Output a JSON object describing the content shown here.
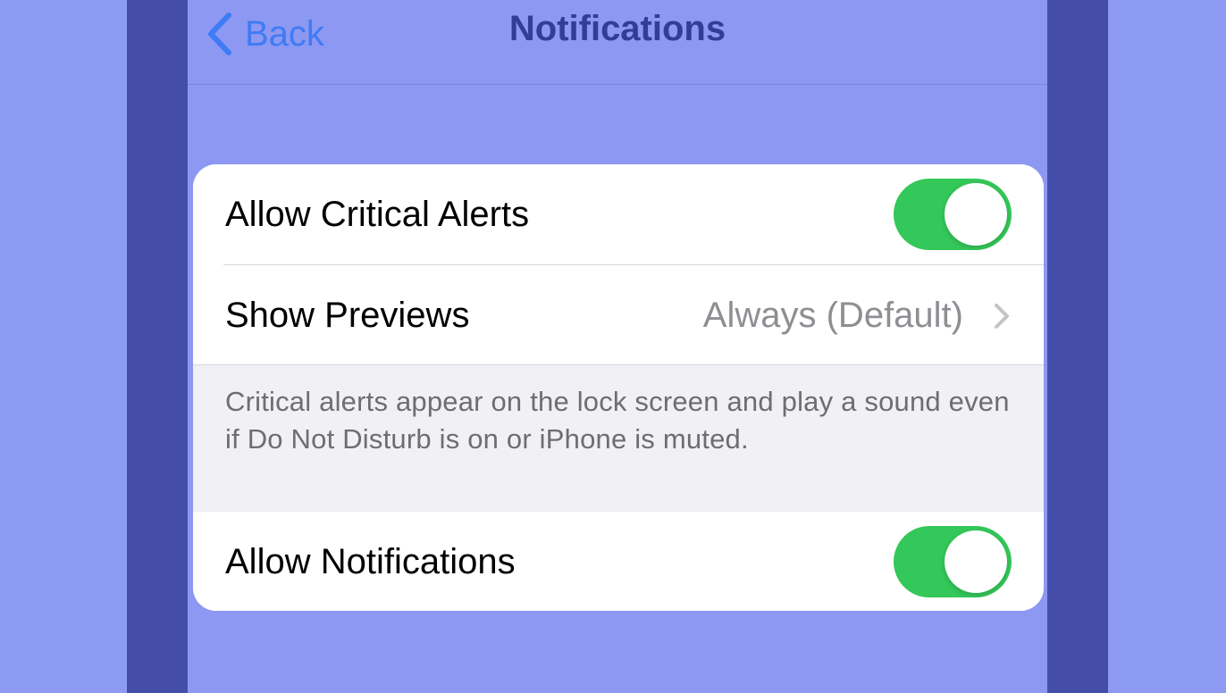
{
  "navbar": {
    "back_label": "Back",
    "title": "Notifications"
  },
  "settings": {
    "critical_alerts": {
      "label": "Allow Critical Alerts",
      "enabled": true
    },
    "show_previews": {
      "label": "Show Previews",
      "value": "Always (Default)"
    },
    "footer_note": "Critical alerts appear on the lock screen and play a sound even if Do Not Disturb is on or iPhone is muted.",
    "allow_notifications": {
      "label": "Allow Notifications",
      "enabled": true
    }
  },
  "colors": {
    "accent": "#3f7bf4",
    "toggle_on": "#34c759",
    "background": "#8e9bf2",
    "side_bar": "#444ea8"
  }
}
